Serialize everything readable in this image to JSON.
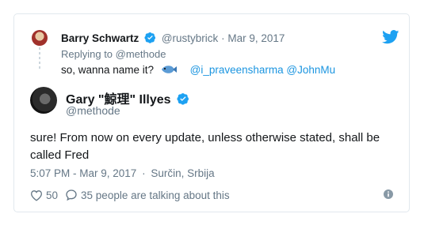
{
  "parent": {
    "name": "Barry Schwartz",
    "handle": "@rustybrick",
    "date_sep": "·",
    "date": "Mar 9, 2017",
    "replying_to": "Replying to @methode",
    "text": "so, wanna name it?",
    "emoji": "fish-icon",
    "mentions": [
      "@i_praveensharma",
      "@JohnMu"
    ]
  },
  "tweet": {
    "name": "Gary \"鯨理\" Illyes",
    "handle": "@methode",
    "text": "sure! From now on every update, unless otherwise stated, shall be called Fred",
    "time": "5:07 PM - Mar 9, 2017",
    "meta_sep": "·",
    "location": "Surčin, Srbija",
    "likes": "50",
    "talking": "35 people are talking about this"
  },
  "colors": {
    "twitter_blue": "#1da1f2",
    "link": "#1b95e0",
    "muted": "#657786",
    "text": "#14171a",
    "border": "#e1e8ed"
  },
  "icons": [
    "twitter-bird-icon",
    "verified-icon",
    "fish-icon",
    "heart-icon",
    "reply-icon",
    "info-icon",
    "location-pin-icon"
  ]
}
